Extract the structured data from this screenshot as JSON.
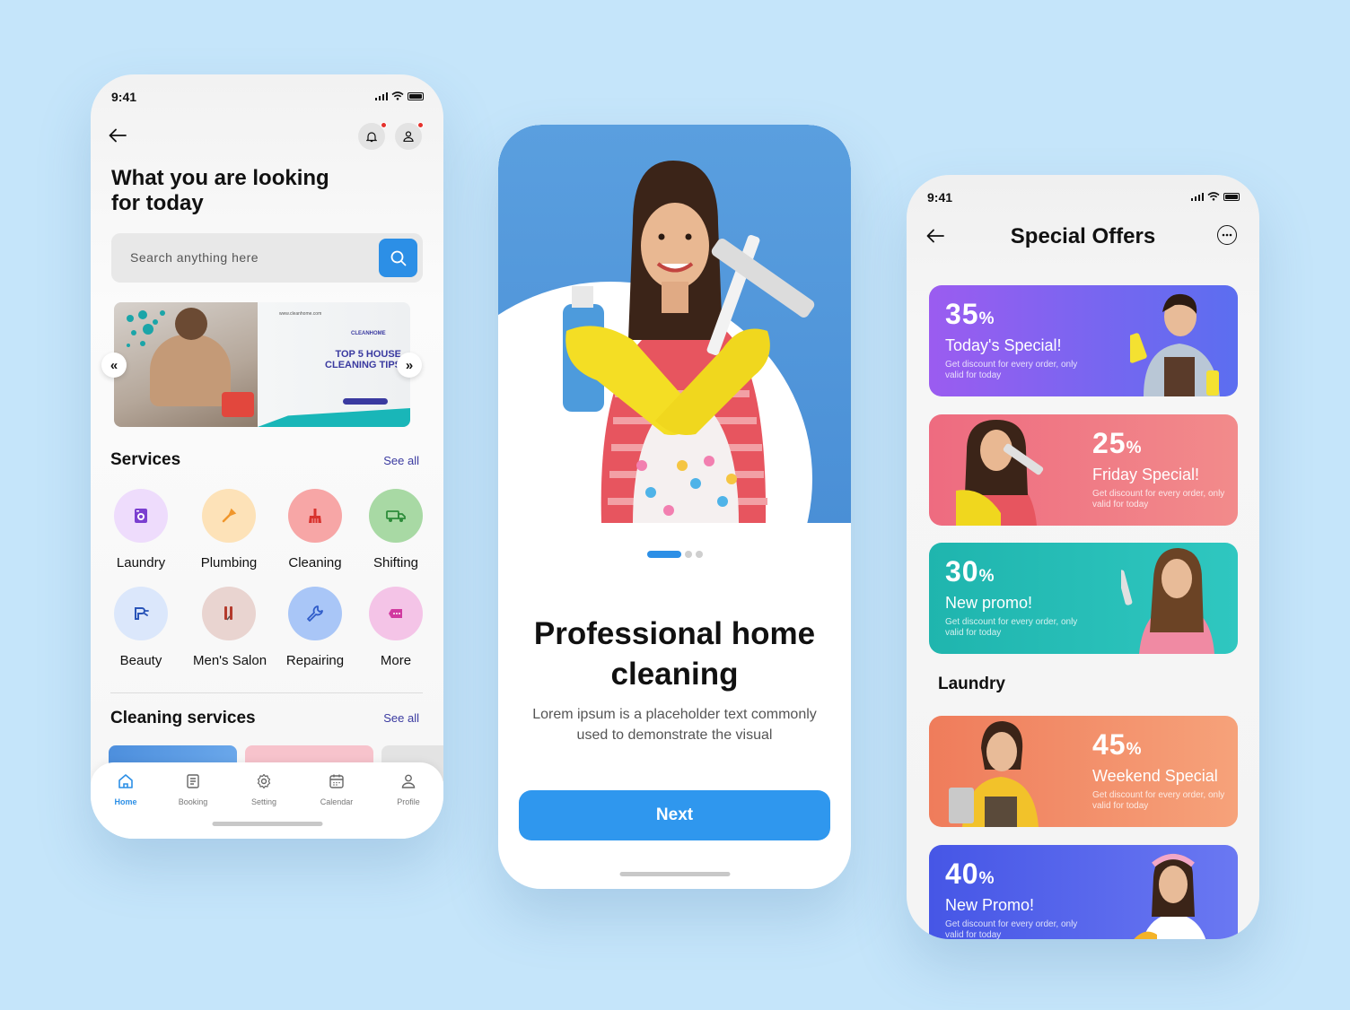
{
  "colors": {
    "background": "#c5e5fa",
    "accent": "#2c8fe6",
    "link": "#3a3aa0",
    "notification_dot": "#e5322d"
  },
  "phone1": {
    "status_time": "9:41",
    "title": "What you are looking for today",
    "search_placeholder": "Search anything here",
    "banner": {
      "brand": "CLEANHOME",
      "url": "www.cleanhome.com",
      "headline": "TOP 5 HOUSE CLEANING TIPS",
      "prev": "«",
      "next": "»"
    },
    "services": {
      "title": "Services",
      "see_all": "See all",
      "items": [
        {
          "label": "Laundry",
          "icon": "washing-machine-icon",
          "bg": "#eedcfc",
          "fg": "#7b3fd0"
        },
        {
          "label": "Plumbing",
          "icon": "wrench-icon",
          "bg": "#fde2b8",
          "fg": "#f0962b"
        },
        {
          "label": "Cleaning",
          "icon": "broom-icon",
          "bg": "#f7a6a6",
          "fg": "#d8322d"
        },
        {
          "label": "Shifting",
          "icon": "truck-icon",
          "bg": "#a8d9a4",
          "fg": "#2d8c3a"
        },
        {
          "label": "Beauty",
          "icon": "hair-dryer-icon",
          "bg": "#dbe7fb",
          "fg": "#2954b8"
        },
        {
          "label": "Men's Salon",
          "icon": "scissors-icon",
          "bg": "#e9d4d0",
          "fg": "#b43a2c"
        },
        {
          "label": "Repairing",
          "icon": "repair-wrench-icon",
          "bg": "#a9c6f7",
          "fg": "#2f5cc9"
        },
        {
          "label": "More",
          "icon": "more-dots-icon",
          "bg": "#f4c4e7",
          "fg": "#d13aa0"
        }
      ]
    },
    "cleaning_services": {
      "title": "Cleaning services",
      "see_all": "See all"
    },
    "tabs": [
      {
        "label": "Home",
        "icon": "home-icon",
        "active": true
      },
      {
        "label": "Booking",
        "icon": "booking-icon",
        "active": false
      },
      {
        "label": "Setting",
        "icon": "gear-icon",
        "active": false
      },
      {
        "label": "Calendar",
        "icon": "calendar-icon",
        "active": false
      },
      {
        "label": "Profile",
        "icon": "user-icon",
        "active": false
      }
    ]
  },
  "phone2": {
    "title": "Professional home cleaning",
    "description": "Lorem ipsum is a placeholder text commonly used to demonstrate the visual",
    "next_label": "Next",
    "pager": {
      "pages": 3,
      "current": 1
    }
  },
  "phone3": {
    "status_time": "9:41",
    "title": "Special Offers",
    "section_label": "Laundry",
    "offers": [
      {
        "percent": "35",
        "title": "Today's Special!",
        "desc": "Get discount for every order, only valid for today",
        "gradient": [
          "#9b5cf0",
          "#5b6ef0"
        ],
        "align": "left"
      },
      {
        "percent": "25",
        "title": "Friday Special!",
        "desc": "Get discount for every order, only valid for today",
        "gradient": [
          "#ee6b80",
          "#f28b8b"
        ],
        "align": "right"
      },
      {
        "percent": "30",
        "title": "New promo!",
        "desc": "Get discount for every order, only valid for today",
        "gradient": [
          "#1fb5ae",
          "#2fc7c0"
        ],
        "align": "left"
      },
      {
        "percent": "45",
        "title": "Weekend Special",
        "desc": "Get discount for every order, only valid for today",
        "gradient": [
          "#ef7c5b",
          "#f6a27a"
        ],
        "align": "right"
      },
      {
        "percent": "40",
        "title": "New Promo!",
        "desc": "Get discount for every order, only valid for today",
        "gradient": [
          "#4656e6",
          "#6a78f2"
        ],
        "align": "left"
      }
    ]
  }
}
